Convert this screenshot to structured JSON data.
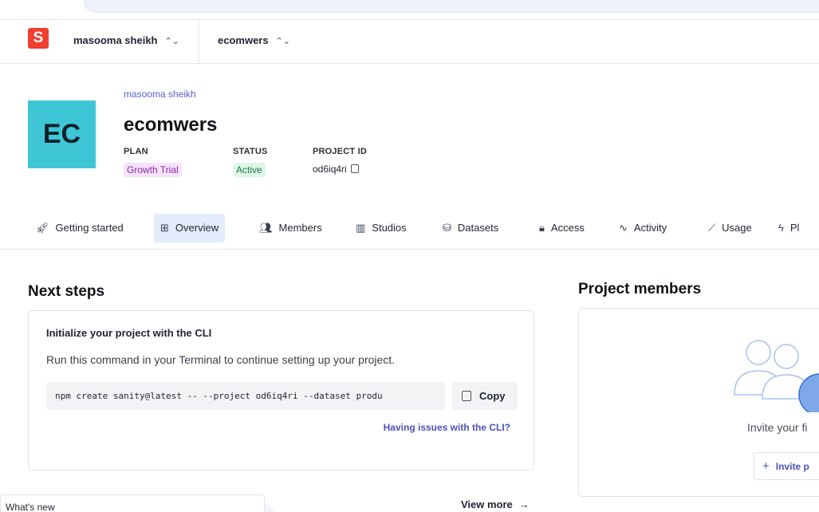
{
  "org_bar": {
    "logo_letter": "S",
    "organization": "masooma sheikh",
    "project": "ecomwers",
    "chevron": "⌃⌄"
  },
  "project_header": {
    "avatar_initials": "EC",
    "organization_link": "masooma sheikh",
    "title": "ecomwers",
    "plan_label": "PLAN",
    "plan_value": "Growth Trial",
    "status_label": "STATUS",
    "status_value": "Active",
    "project_id_label": "PROJECT ID",
    "project_id_value": "od6iq4ri"
  },
  "tabs": [
    {
      "label": "Getting started",
      "icon": "rocket-icon",
      "active": false
    },
    {
      "label": "Overview",
      "icon": "overview-icon",
      "active": true
    },
    {
      "label": "Members",
      "icon": "users-icon",
      "active": false
    },
    {
      "label": "Studios",
      "icon": "studio-icon",
      "active": false
    },
    {
      "label": "Datasets",
      "icon": "database-icon",
      "active": false
    },
    {
      "label": "Access",
      "icon": "lock-icon",
      "active": false
    },
    {
      "label": "Activity",
      "icon": "activity-icon",
      "active": false
    },
    {
      "label": "Usage",
      "icon": "chart-icon",
      "active": false
    },
    {
      "label": "Pl",
      "icon": "plug-icon",
      "active": false
    }
  ],
  "next_steps": {
    "heading": "Next steps",
    "card_title": "Initialize your project with the CLI",
    "card_text": "Run this command in your Terminal to continue setting up your project.",
    "command": "npm create sanity@latest -- --project od6iq4ri --dataset produ",
    "copy_label": "Copy",
    "help_link": "Having issues with the CLI?"
  },
  "project_members": {
    "heading": "Project members",
    "invite_text": "Invite your fi",
    "invite_button": "Invite p"
  },
  "whats_new": {
    "label": "What's new",
    "view_more": "View more"
  },
  "colors": {
    "brand_red": "#f03e2f",
    "avatar_teal": "#3ec6d6",
    "link_purple": "#4b52b8",
    "active_tab_bg": "#e4ecfb"
  }
}
